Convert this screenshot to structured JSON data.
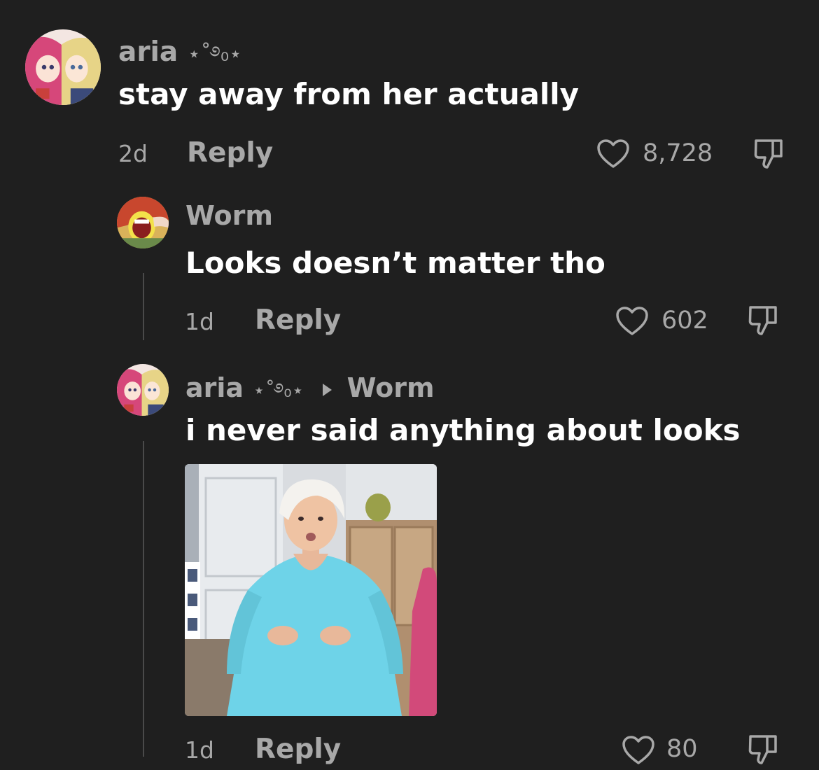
{
  "comments": [
    {
      "username": "aria",
      "username_deco": "⋆˚࿔₀⋆",
      "text": "stay away from her actually",
      "time": "2d",
      "reply_label": "Reply",
      "likes": "8,728"
    },
    {
      "username": "Worm",
      "text": "Looks doesn’t matter tho",
      "time": "1d",
      "reply_label": "Reply",
      "likes": "602"
    },
    {
      "username": "aria",
      "username_deco": "⋆˚࿔₀⋆",
      "reply_to": "Worm",
      "text": "i never said anything about looks",
      "time": "1d",
      "reply_label": "Reply",
      "likes": "80"
    }
  ],
  "icons": {
    "like": "heart-outline-icon",
    "dislike": "thumbs-down-icon",
    "reply_arrow": "triangle-right-icon"
  },
  "colors": {
    "background": "#1f1f1f",
    "secondary_text": "#a8a8a8",
    "primary_text": "#ffffff"
  }
}
